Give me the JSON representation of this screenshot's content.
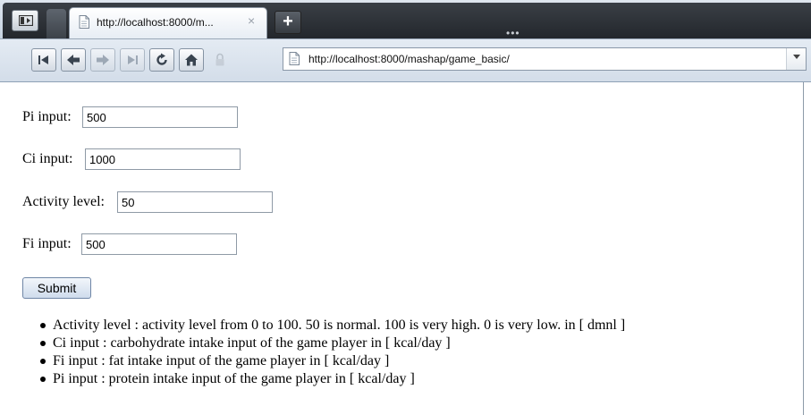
{
  "browser": {
    "tab_title": "http://localhost:8000/m...",
    "tab_close": "×",
    "new_tab": "+",
    "tab_overflow": "•••",
    "url": "http://localhost:8000/mashap/game_basic/"
  },
  "form": {
    "fields": [
      {
        "label": "Pi input:",
        "value": "500"
      },
      {
        "label": "Ci input:",
        "value": "1000"
      },
      {
        "label": "Activity level:",
        "value": "50"
      },
      {
        "label": "Fi input:",
        "value": "500"
      }
    ],
    "submit_label": "Submit"
  },
  "descriptions": [
    "Activity level : activity level from 0 to 100. 50 is normal. 100 is very high. 0 is very low. in [ dmnl ]",
    "Ci input : carbohydrate intake input of the game player in [ kcal/day ]",
    "Fi input : fat intake input of the game player in [ kcal/day ]",
    "Pi input : protein intake input of the game player in [ kcal/day ]"
  ],
  "icons": {
    "tab_switch": "tab-switch-icon",
    "favicon": "page-icon",
    "first": "first-icon",
    "back": "back-arrow-icon",
    "forward": "forward-arrow-icon",
    "last": "last-icon",
    "reload": "reload-icon",
    "home": "home-icon",
    "security": "lock-icon",
    "dropdown": "chevron-down-icon"
  }
}
